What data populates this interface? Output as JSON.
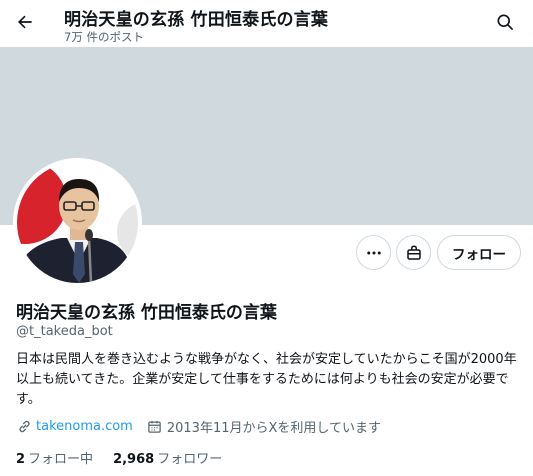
{
  "header": {
    "title": "明治天皇の玄孫 竹田恒泰氏の言葉",
    "post_count": "7万 件のポスト"
  },
  "icons": {
    "back": "arrow-left-icon",
    "search": "search-icon",
    "more": "more-horizontal-icon",
    "shop": "shopping-bag-icon",
    "link": "link-icon",
    "calendar": "calendar-icon"
  },
  "profile": {
    "name": "明治天皇の玄孫 竹田恒泰氏の言葉",
    "handle": "@t_takeda_bot",
    "bio": "日本は民間人を巻き込むような戦争がなく、社会が安定していたからこそ国が2000年以上も続いてきた。企業が安定して仕事をするためには何よりも社会の安定が必要です。",
    "website": "takenoma.com",
    "joined": "2013年11月からXを利用しています"
  },
  "actions": {
    "follow_label": "フォロー"
  },
  "stats": {
    "following_count": "2",
    "following_label": "フォロー中",
    "followers_count": "2,968",
    "followers_label": "フォロワー"
  },
  "colors": {
    "banner": "#cfd9de",
    "link": "#1d9bf0",
    "muted": "#536471",
    "text": "#0f1419"
  }
}
